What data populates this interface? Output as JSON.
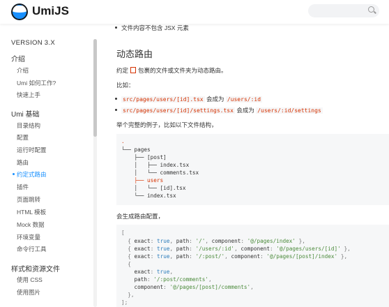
{
  "header": {
    "brand": "UmiJS",
    "search_placeholder": ""
  },
  "sidebar": {
    "version": "VERSION 3.X",
    "groups": [
      {
        "title": "介绍",
        "items": [
          "介绍",
          "Umi 如何工作?",
          "快速上手"
        ]
      },
      {
        "title": "Umi 基础",
        "items": [
          "目录结构",
          "配置",
          "运行时配置",
          "路由",
          "约定式路由",
          "插件",
          "页面跳转",
          "HTML 模板",
          "Mock 数据",
          "环境变量",
          "命令行工具"
        ]
      },
      {
        "title": "样式和资源文件",
        "items": [
          "使用 CSS",
          "使用图片"
        ]
      }
    ],
    "active_item": "约定式路由"
  },
  "content": {
    "bullet_top": "文件内容不包含 JSX 元素",
    "heading": "动态路由",
    "para1_before": "约定",
    "para1_after": "包裹的文件或文件夹为动态路由。",
    "para2": "比如：",
    "bullets": [
      {
        "code": "src/pages/users/[id].tsx",
        "mid": "会成为",
        "route": "/users/:id"
      },
      {
        "code": "src/pages/users/[id]/settings.tsx",
        "mid": "会成为",
        "route": "/users/:id/settings"
      }
    ],
    "para3": "举个完整的例子，比如以下文件结构，",
    "tree": {
      "root": ".",
      "lines": [
        "└── pages",
        "    ├── [post]",
        "    │   ├── index.tsx",
        "    │   └── comments.tsx",
        "    ├── users",
        "    │   └── [id].tsx",
        "    └── index.tsx"
      ]
    },
    "para4": "会生成路由配置，",
    "routes_code": {
      "open": "[",
      "r1": {
        "exact": "true",
        "path": "'/'",
        "component": "'@/pages/index'"
      },
      "r2": {
        "exact": "true",
        "path": "'/users/:id'",
        "component": "'@/pages/users/[id]'"
      },
      "r3": {
        "exact": "true",
        "path": "'/:post/'",
        "component": "'@/pages/[post]/index'"
      },
      "r4": {
        "exact": "true",
        "path": "'/:post/comments'",
        "component": "'@/pages/[post]/comments'"
      },
      "close": "];"
    }
  },
  "colors": {
    "accent": "#1890ff",
    "code_red": "#d63200",
    "code_bg": "#f6f7f8"
  }
}
